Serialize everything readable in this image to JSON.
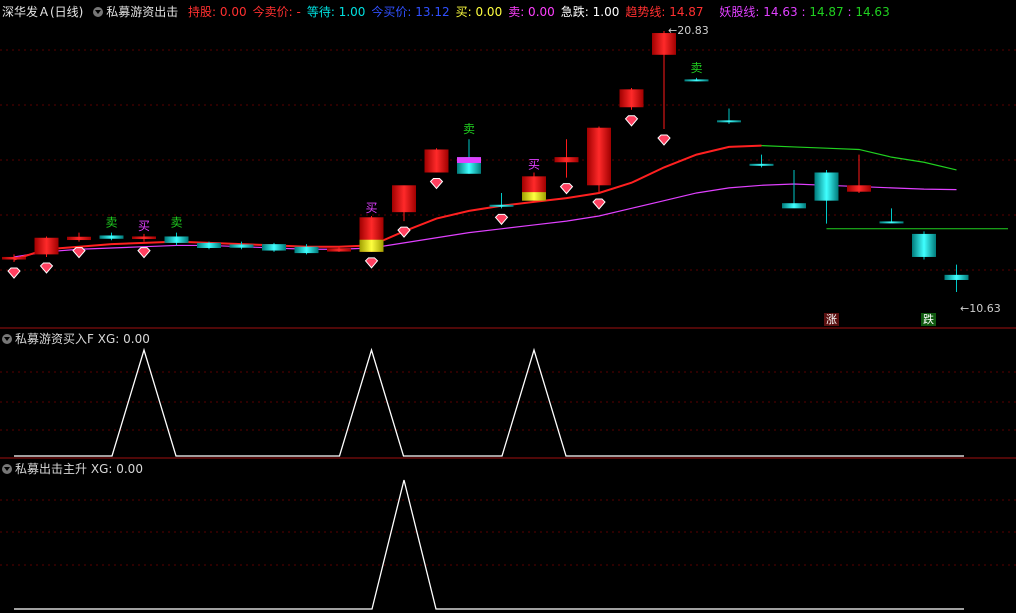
{
  "header": {
    "stock": "深华发Ａ(日线)",
    "indicator": "私募游资出击",
    "items": [
      {
        "label": "持股",
        "value": "0.00",
        "color": "#ff3030"
      },
      {
        "label": "今卖价",
        "value": "-",
        "color": "#ff3030"
      },
      {
        "label": "等待",
        "value": "1.00",
        "color": "#00e0e0"
      },
      {
        "label": "今买价",
        "value": "13.12",
        "color": "#3050ff"
      },
      {
        "label": "买",
        "value": "0.00",
        "color": "#ffff40"
      },
      {
        "label": "卖",
        "value": "0.00",
        "color": "#ff40ff"
      },
      {
        "label": "急跌",
        "value": "1.00",
        "color": "#ffffff"
      },
      {
        "label": "趋势线",
        "value": "14.87",
        "color": "#ff3030"
      }
    ],
    "yaoguxian": {
      "label": "妖股线",
      "v1": "14.63",
      "v2": "14.87",
      "v3": "14.63"
    }
  },
  "sub1": {
    "title": "私募游资买入F",
    "xg_label": "XG",
    "xg_value": "0.00"
  },
  "sub2": {
    "title": "私募出击主升",
    "xg_label": "XG",
    "xg_value": "0.00"
  },
  "labels": {
    "high": "20.83",
    "low": "10.63",
    "zhang": "涨",
    "die": "跌",
    "buy": "买",
    "sell": "卖"
  },
  "colors": {
    "up": "#ff1a1a",
    "down": "#00c8c8",
    "trend": "#ff2020",
    "yao": "#e040ff",
    "green": "#20d020",
    "bg": "#000000"
  },
  "chart_data": {
    "type": "candlestick",
    "ylim": [
      10.63,
      20.83
    ],
    "candles": [
      {
        "o": 11.9,
        "h": 12.1,
        "l": 11.8,
        "c": 12.0,
        "t": "up"
      },
      {
        "o": 12.1,
        "h": 12.8,
        "l": 12.0,
        "c": 12.75,
        "t": "up"
      },
      {
        "o": 12.7,
        "h": 12.95,
        "l": 12.6,
        "c": 12.75,
        "t": "up"
      },
      {
        "o": 12.8,
        "h": 12.95,
        "l": 12.65,
        "c": 12.75,
        "t": "down"
      },
      {
        "o": 12.7,
        "h": 12.9,
        "l": 12.6,
        "c": 12.8,
        "t": "up"
      },
      {
        "o": 12.8,
        "h": 12.95,
        "l": 12.45,
        "c": 12.55,
        "t": "down"
      },
      {
        "o": 12.55,
        "h": 12.6,
        "l": 12.3,
        "c": 12.35,
        "t": "down"
      },
      {
        "o": 12.45,
        "h": 12.6,
        "l": 12.3,
        "c": 12.4,
        "t": "down"
      },
      {
        "o": 12.5,
        "h": 12.55,
        "l": 12.2,
        "c": 12.25,
        "t": "down"
      },
      {
        "o": 12.4,
        "h": 12.5,
        "l": 12.1,
        "c": 12.15,
        "t": "down"
      },
      {
        "o": 12.25,
        "h": 12.4,
        "l": 12.2,
        "c": 12.3,
        "t": "up"
      },
      {
        "o": 12.2,
        "h": 13.6,
        "l": 12.2,
        "c": 13.55,
        "t": "up"
      },
      {
        "o": 13.75,
        "h": 14.7,
        "l": 13.4,
        "c": 14.8,
        "t": "up"
      },
      {
        "o": 15.3,
        "h": 16.25,
        "l": 15.3,
        "c": 16.2,
        "t": "up"
      },
      {
        "o": 15.9,
        "h": 16.6,
        "l": 15.25,
        "c": 15.25,
        "t": "down"
      },
      {
        "o": 14.0,
        "h": 14.5,
        "l": 13.9,
        "c": 14.0,
        "t": "down"
      },
      {
        "o": 14.2,
        "h": 15.3,
        "l": 14.2,
        "c": 15.15,
        "t": "up"
      },
      {
        "o": 15.9,
        "h": 16.6,
        "l": 15.1,
        "c": 15.7,
        "t": "up"
      },
      {
        "o": 14.8,
        "h": 17.1,
        "l": 14.5,
        "c": 17.05,
        "t": "up"
      },
      {
        "o": 17.85,
        "h": 18.6,
        "l": 17.75,
        "c": 18.55,
        "t": "up"
      },
      {
        "o": 19.9,
        "h": 20.83,
        "l": 17.0,
        "c": 20.75,
        "t": "up"
      },
      {
        "o": 18.9,
        "h": 19.0,
        "l": 18.9,
        "c": 18.9,
        "t": "down"
      },
      {
        "o": 17.3,
        "h": 17.8,
        "l": 17.2,
        "c": 17.3,
        "t": "down"
      },
      {
        "o": 15.6,
        "h": 16.0,
        "l": 15.5,
        "c": 15.6,
        "t": "down"
      },
      {
        "o": 14.1,
        "h": 15.4,
        "l": 13.95,
        "c": 13.9,
        "t": "down"
      },
      {
        "o": 15.3,
        "h": 15.4,
        "l": 13.3,
        "c": 14.2,
        "t": "down"
      },
      {
        "o": 14.8,
        "h": 16.0,
        "l": 14.5,
        "c": 14.55,
        "t": "up"
      },
      {
        "o": 13.35,
        "h": 13.9,
        "l": 13.35,
        "c": 13.35,
        "t": "down"
      },
      {
        "o": 12.9,
        "h": 13.0,
        "l": 11.9,
        "c": 12.0,
        "t": "down"
      },
      {
        "o": 11.3,
        "h": 11.7,
        "l": 10.63,
        "c": 11.1,
        "t": "down"
      }
    ],
    "trend_line": [
      11.9,
      12.3,
      12.4,
      12.5,
      12.55,
      12.6,
      12.55,
      12.5,
      12.45,
      12.4,
      12.4,
      12.45,
      13.0,
      13.5,
      13.8,
      14.0,
      14.15,
      14.3,
      14.5,
      14.9,
      15.5,
      16.0,
      16.3,
      16.35,
      16.3,
      16.25,
      16.2,
      15.9,
      15.7,
      15.4
    ],
    "yao_line": [
      12.0,
      12.2,
      12.3,
      12.35,
      12.4,
      12.45,
      12.45,
      12.4,
      12.35,
      12.3,
      12.3,
      12.35,
      12.55,
      12.75,
      12.95,
      13.1,
      13.25,
      13.4,
      13.6,
      13.9,
      14.2,
      14.5,
      14.7,
      14.8,
      14.85,
      14.8,
      14.75,
      14.7,
      14.65,
      14.63
    ],
    "buy_marks": [
      4,
      11,
      16
    ],
    "sell_marks": [
      3,
      5,
      14,
      21
    ],
    "diamonds": [
      0,
      1,
      2,
      4,
      11,
      12,
      13,
      15,
      17,
      18,
      19,
      20
    ],
    "sub1_peaks": [
      4,
      11,
      16
    ],
    "sub2_peaks": [
      12
    ]
  }
}
